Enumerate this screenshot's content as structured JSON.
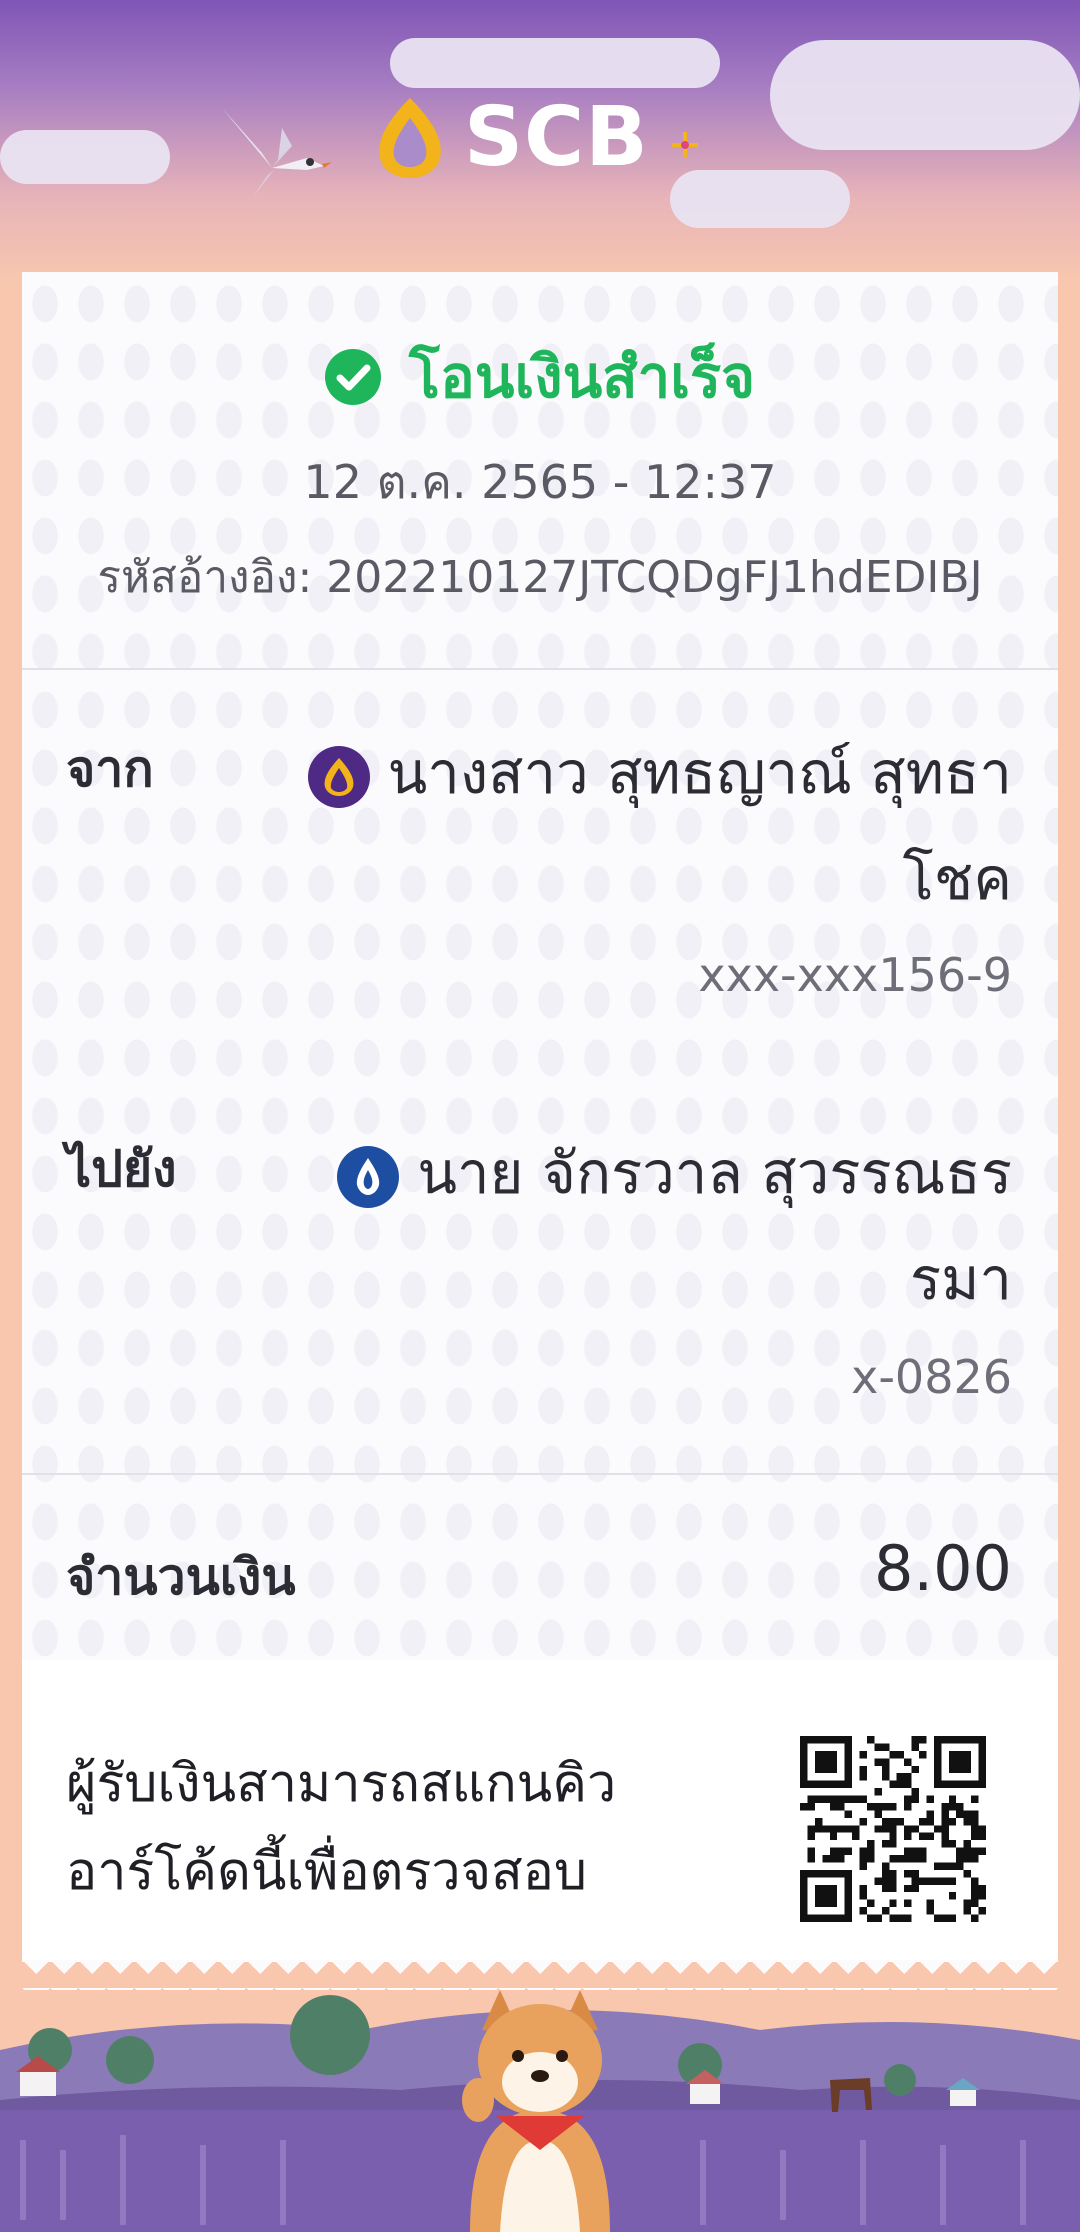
{
  "brand": {
    "name": "SCB"
  },
  "receipt": {
    "status": "โอนเงินสำเร็จ",
    "datetime": "12 ต.ค. 2565 - 12:37",
    "reference_label": "รหัสอ้างอิง:",
    "reference_value": "202210127JTCQDgFJ1hdEDIBJ"
  },
  "from": {
    "label": "จาก",
    "name_line1": "นางสาว สุทธญาณ์ สุทธา",
    "name_line2": "โชค",
    "account": "xxx-xxx156-9",
    "bank_icon": "scb-bank-icon"
  },
  "to": {
    "label": "ไปยัง",
    "name_line1": "นาย จักรวาล สุวรรณธร",
    "name_line2": "รมา",
    "account": "x-0826",
    "bank_icon": "bangkok-bank-icon"
  },
  "amount": {
    "label": "จำนวนเงิน",
    "value": "8.00"
  },
  "qr": {
    "text_line1": "ผู้รับเงินสามารถสแกนคิว",
    "text_line2": "อาร์โค้ดนี้เพื่อตรวจสอบ",
    "icon": "qr-code-icon"
  },
  "colors": {
    "success": "#1fb55a",
    "scb_purple": "#4e2a84",
    "scb_gold": "#f3b31a",
    "bbl_blue": "#1e4ea1"
  }
}
